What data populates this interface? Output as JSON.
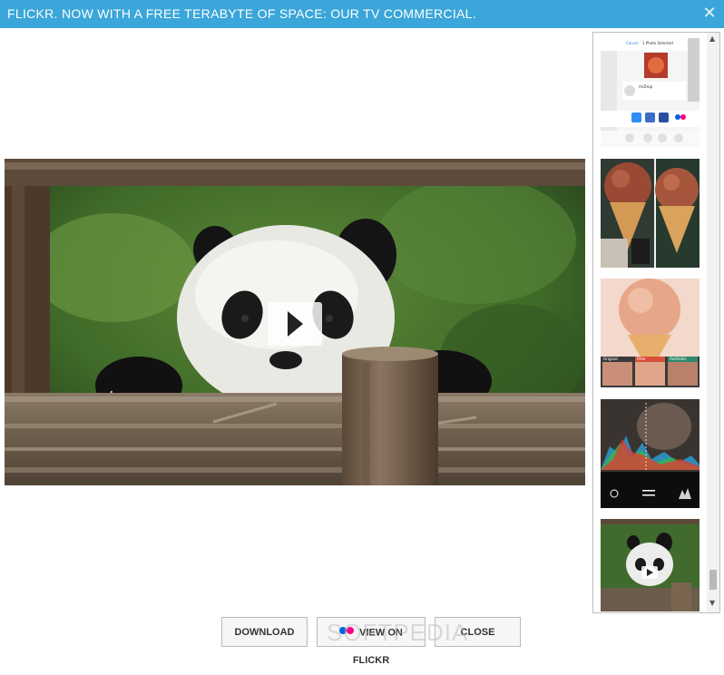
{
  "window": {
    "title": "FLICKR. NOW WITH A FREE TERABYTE OF SPACE: OUR TV COMMERCIAL.",
    "close_glyph": "✕"
  },
  "colors": {
    "titlebar": "#3aa6d9",
    "flickr_blue": "#0063dc",
    "flickr_pink": "#ff0084"
  },
  "thumbnails": {
    "items": [
      {
        "name": "share-sheet-screenshot",
        "header": "1 Photo Selected",
        "cancel": "Cancel",
        "airdrop": "AirDrop"
      },
      {
        "name": "ice-cream-cone-comparison"
      },
      {
        "name": "ice-cream-cone-filters",
        "labels": [
          "Original",
          "Filter",
          "Aesthetic"
        ]
      },
      {
        "name": "histogram-editor"
      },
      {
        "name": "panda-video-thumbnail"
      }
    ]
  },
  "buttons": {
    "download": "DOWNLOAD",
    "view_on_flickr": "VIEW ON FLICKR",
    "close": "CLOSE"
  },
  "watermark": "SOFTPEDIA"
}
